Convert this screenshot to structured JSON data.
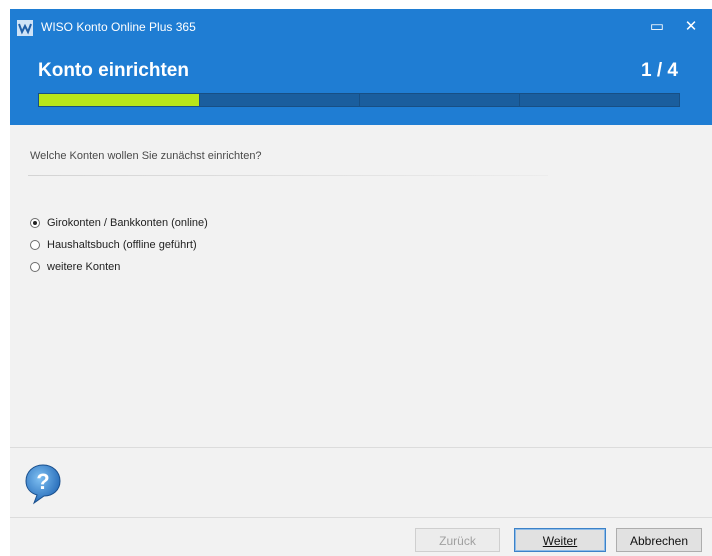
{
  "window": {
    "title": "WISO Konto Online Plus 365",
    "maximize_glyph": "▭",
    "close_glyph": "✕"
  },
  "header": {
    "title": "Konto einrichten",
    "step": "1 / 4",
    "progress_steps_total": 4,
    "progress_steps_done": 1
  },
  "content": {
    "question": "Welche Konten wollen Sie zunächst einrichten?",
    "options": [
      {
        "label": "Girokonten / Bankkonten (online)",
        "checked": true
      },
      {
        "label": "Haushaltsbuch (offline geführt)",
        "checked": false
      },
      {
        "label": "weitere Konten",
        "checked": false
      }
    ]
  },
  "footer": {
    "back_label": "Zurück",
    "next_label": "Weiter",
    "cancel_label": "Abbrechen"
  },
  "colors": {
    "titlebar": "#1f7dd3",
    "progress_fill": "#b7e61a"
  },
  "icons": {
    "app": "wiso-app-icon",
    "help": "help-question-icon"
  }
}
